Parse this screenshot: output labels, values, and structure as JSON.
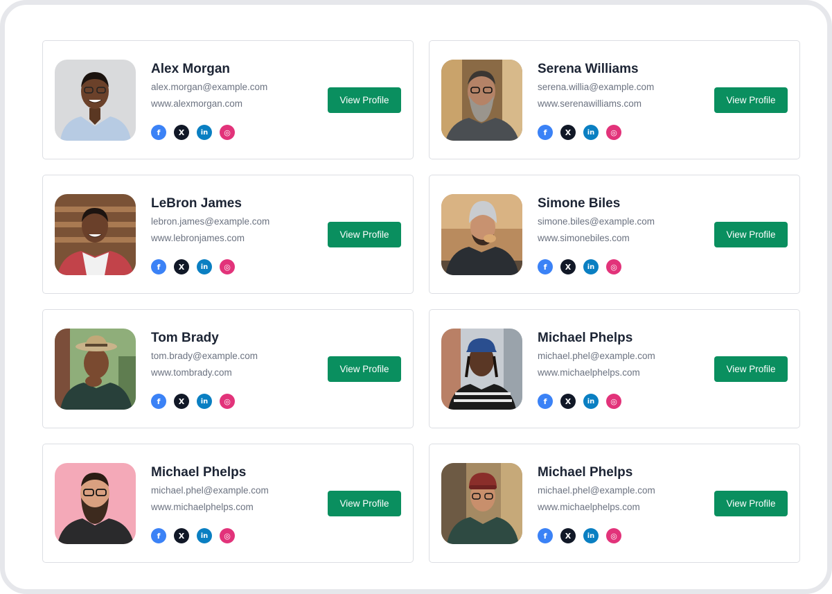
{
  "button_label": "View Profile",
  "colors": {
    "accent": "#0a8f5f",
    "facebook": "#3b82f6",
    "x": "#111827",
    "linkedin": "#0a7fc2",
    "dribbble": "#e2337a",
    "frame": "#e6e7eb"
  },
  "socials": [
    {
      "icon": "facebook-icon",
      "glyph": "f"
    },
    {
      "icon": "x-icon",
      "glyph": "X"
    },
    {
      "icon": "linkedin-icon",
      "glyph": "in"
    },
    {
      "icon": "dribbble-icon",
      "glyph": "◎"
    }
  ],
  "profiles": [
    {
      "name": "Alex Morgan",
      "email": "alex.morgan@example.com",
      "website": "www.alexmorgan.com"
    },
    {
      "name": "Serena Williams",
      "email": "serena.willia@example.com",
      "website": "www.serenawilliams.com"
    },
    {
      "name": "LeBron James",
      "email": "lebron.james@example.com",
      "website": "www.lebronjames.com"
    },
    {
      "name": "Simone Biles",
      "email": "simone.biles@example.com",
      "website": "www.simonebiles.com"
    },
    {
      "name": "Tom Brady",
      "email": "tom.brady@example.com",
      "website": "www.tombrady.com"
    },
    {
      "name": "Michael Phelps",
      "email": "michael.phel@example.com",
      "website": "www.michaelphelps.com"
    },
    {
      "name": "Michael Phelps",
      "email": "michael.phel@example.com",
      "website": "www.michaelphelps.com"
    },
    {
      "name": "Michael Phelps",
      "email": "michael.phel@example.com",
      "website": "www.michaelphelps.com"
    }
  ]
}
